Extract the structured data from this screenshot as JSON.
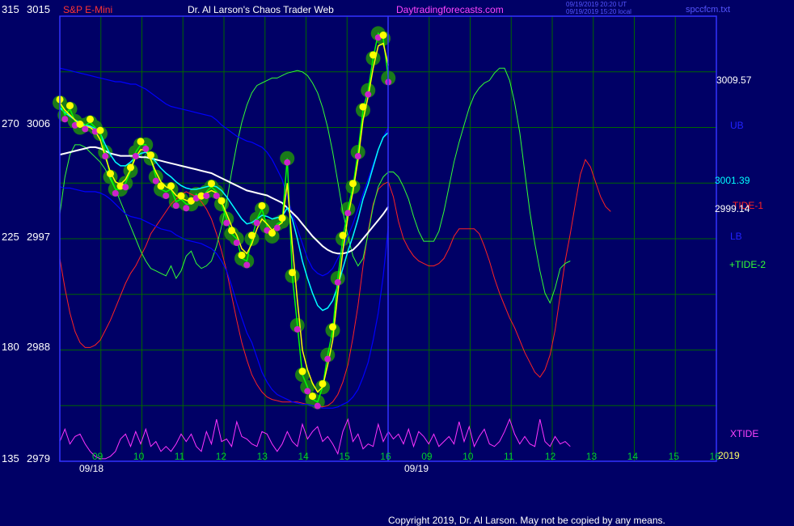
{
  "header": {
    "instrument": "S&P E-Mini",
    "site_title": "Dr. Al Larson's Chaos Trader Web",
    "site_url": "Daytradingforecasts.com",
    "timestamp_utc": "09/19/2019 20:20 UT",
    "timestamp_local": "09/19/2019 15:20 local",
    "file_name": "spccfcm.txt"
  },
  "footer": {
    "copyright": "Copyright 2019, Dr. Al Larson. May not be copied by any means."
  },
  "colors": {
    "background": "#000066",
    "border": "#3333ff",
    "grid": "#006600",
    "price": "#00ff00",
    "ub_lb": "#0000ff",
    "cyan_avg": "#00ffff",
    "white_avg": "#ffffff",
    "yellow_avg": "#ffff00",
    "tide1": "#ff2222",
    "tide2": "#33ff33",
    "xtide": "#ff33ff"
  },
  "chart_data": {
    "type": "line",
    "left_axis_a": [
      "315",
      "270",
      "225",
      "180",
      "135"
    ],
    "left_axis_b": [
      "3015",
      "3006",
      "2997",
      "2988",
      "2979"
    ],
    "price_range": [
      2979,
      3015
    ],
    "x_hour_labels": [
      "09",
      "10",
      "11",
      "12",
      "13",
      "14",
      "15",
      "16",
      "09",
      "10",
      "11",
      "12",
      "13",
      "14",
      "15",
      "16"
    ],
    "date_labels": [
      "09/18",
      "09/19"
    ],
    "year_label": "2019",
    "right_labels": {
      "upper_value": "3009.57",
      "ub": "UB",
      "mid_value": "3001.39",
      "tide1": "TIDE-1",
      "close_value": "2999.14",
      "lb": "LB",
      "tide2": "+TIDE-2",
      "xtide": "XTIDE"
    },
    "series": [
      {
        "key": "price",
        "values": [
          3008,
          3007,
          3007.5,
          3006.5,
          3006,
          3006.2,
          3006.4,
          3006,
          3005.5,
          3004,
          3002,
          3001,
          3001,
          3001.5,
          3002.5,
          3004,
          3004.6,
          3004.6,
          3003.5,
          3002,
          3001,
          3000.8,
          3001,
          3000,
          3000.2,
          2999.8,
          2999.8,
          3000.6,
          3000.2,
          3000.8,
          3001.2,
          3000.8,
          2999.8,
          2998.6,
          2997.4,
          2997,
          2995.4,
          2995.2,
          2997,
          2998.6,
          2999.4,
          2998,
          2997.2,
          2998.2,
          2998.4,
          3003.5,
          2994,
          2990,
          2986,
          2985,
          2984,
          2983.8,
          2985,
          2987.6,
          2989.6,
          2993.8,
          2997,
          2999.4,
          3001.2,
          3004,
          3007.4,
          3009,
          3011.6,
          3013.6,
          3013.2,
          3010
        ]
      },
      {
        "key": "yellow",
        "values": [
          3008,
          3007.4,
          3007,
          3006.6,
          3006.2,
          3006.1,
          3006,
          3005.7,
          3005,
          3003.6,
          3002.4,
          3001.6,
          3001.4,
          3001.8,
          3002.6,
          3003.6,
          3004.2,
          3004.2,
          3003.4,
          3002.4,
          3001.6,
          3001.2,
          3001,
          3000.5,
          3000.3,
          3000.1,
          3000,
          3000.3,
          3000.4,
          3000.7,
          3000.9,
          3000.7,
          3000,
          2999,
          2998,
          2997.3,
          2996.2,
          2995.8,
          2996.6,
          2997.8,
          2998.6,
          2998.2,
          2997.7,
          2998,
          2998.3,
          3001.5,
          2996.5,
          2992,
          2988,
          2986.4,
          2985.3,
          2984.6,
          2985,
          2986.8,
          2988.8,
          2992.6,
          2996,
          2998.8,
          3000.8,
          3003.4,
          3006.6,
          3008.5,
          3010.8,
          3012.6,
          3012.8,
          3011
        ]
      },
      {
        "key": "cyan",
        "values": [
          3007.6,
          3007.2,
          3006.9,
          3006.6,
          3006.4,
          3006.2,
          3006.1,
          3005.9,
          3005.5,
          3004.6,
          3003.8,
          3003.2,
          3002.9,
          3002.9,
          3003.2,
          3003.6,
          3003.9,
          3004,
          3003.7,
          3003.2,
          3002.7,
          3002.3,
          3002,
          3001.6,
          3001.3,
          3001.1,
          3001,
          3001,
          3001.1,
          3001.2,
          3001.3,
          3001.2,
          3000.9,
          3000.4,
          2999.8,
          2999.2,
          2998.6,
          2998.2,
          2998.3,
          2998.6,
          2998.9,
          2998.8,
          2998.6,
          2998.7,
          2998.8,
          2999.5,
          2998.6,
          2997,
          2995.2,
          2993.8,
          2992.6,
          2991.6,
          2991.2,
          2991.4,
          2992,
          2993.2,
          2994.6,
          2996,
          2997.2,
          2998.6,
          3000.2,
          3001.4,
          3002.8,
          3004.2,
          3005.2,
          3005.6
        ]
      },
      {
        "key": "white",
        "values": [
          3003.8,
          3003.9,
          3004,
          3004.1,
          3004.2,
          3004.3,
          3004.4,
          3004.4,
          3004.3,
          3004.1,
          3003.9,
          3003.8,
          3003.7,
          3003.7,
          3003.7,
          3003.7,
          3003.6,
          3003.6,
          3003.5,
          3003.4,
          3003.3,
          3003.2,
          3003.1,
          3003,
          3002.9,
          3002.8,
          3002.7,
          3002.6,
          3002.5,
          3002.4,
          3002.3,
          3002.1,
          3001.9,
          3001.7,
          3001.5,
          3001.3,
          3001.1,
          3000.9,
          3000.8,
          3000.7,
          3000.6,
          3000.5,
          3000.3,
          3000.1,
          2999.9,
          2999.5,
          2999.1,
          2998.7,
          2998.2,
          2997.7,
          2997.2,
          2996.8,
          2996.4,
          2996.1,
          2995.9,
          2995.8,
          2995.8,
          2995.9,
          2996.1,
          2996.5,
          2997,
          2997.5,
          2998,
          2998.5,
          2999,
          2999.6
        ]
      },
      {
        "key": "ub",
        "values": [
          3010.8,
          3010.7,
          3010.6,
          3010.5,
          3010.4,
          3010.3,
          3010.2,
          3010.1,
          3010,
          3009.9,
          3009.8,
          3009.7,
          3009.7,
          3009.6,
          3009.5,
          3009.5,
          3009.3,
          3009.1,
          3008.8,
          3008.5,
          3008.2,
          3007.9,
          3007.7,
          3007.6,
          3007.5,
          3007.4,
          3007.3,
          3007.2,
          3007.1,
          3007,
          3006.9,
          3006.6,
          3006.2,
          3005.9,
          3005.6,
          3005.3,
          3005.1,
          3004.9,
          3004.8,
          3004.6,
          3004.4,
          3004,
          3003.4,
          3002.6,
          3001.8,
          3000.4,
          2999,
          2997.8,
          2996.6,
          2995.4,
          2994.6,
          2994.2,
          2994,
          2994.2,
          2994.6,
          2995.4,
          2996.2,
          2997.2,
          2998.2,
          2999.4,
          3000.6,
          3001.8,
          3003,
          3004.2,
          3005.2,
          3006
        ]
      },
      {
        "key": "lb",
        "values": [
          3001.2,
          3001.1,
          3001.1,
          3001,
          3000.9,
          3000.8,
          3000.8,
          3000.8,
          3000.7,
          3000.5,
          3000.2,
          2999.8,
          2999.4,
          2999,
          2998.8,
          2998.7,
          2998.6,
          2998.4,
          2998.2,
          2998,
          2997.8,
          2997.7,
          2997.6,
          2997.3,
          2997.1,
          2996.9,
          2996.8,
          2996.7,
          2996.6,
          2996.4,
          2996.2,
          2995.8,
          2995.2,
          2994.4,
          2993.2,
          2991.8,
          2990.6,
          2989.4,
          2988.6,
          2987.4,
          2986.2,
          2985.4,
          2984.8,
          2984.4,
          2984.2,
          2984,
          2983.8,
          2983.7,
          2983.6,
          2983.6,
          2983.5,
          2983.4,
          2983.3,
          2983.3,
          2983.3,
          2983.4,
          2983.6,
          2983.8,
          2984.2,
          2984.8,
          2985.8,
          2987,
          2988.8,
          2991,
          2994,
          2998
        ]
      },
      {
        "key": "tide1",
        "values": [
          2995.4,
          2993,
          2991,
          2989.5,
          2988.6,
          2988.2,
          2988.2,
          2988.4,
          2988.8,
          2989.6,
          2990.4,
          2991.4,
          2992.4,
          2993.4,
          2994.2,
          2994.8,
          2995.6,
          2996.4,
          2997.4,
          2998,
          2998.6,
          2999.2,
          2999.8,
          3000.2,
          3000.6,
          3000.8,
          3000.6,
          3000.4,
          3000,
          2999.4,
          2998.6,
          2997.4,
          2996,
          2994.4,
          2992.4,
          2990.4,
          2988.6,
          2987.2,
          2986,
          2985.2,
          2984.6,
          2984.2,
          2984,
          2983.9,
          2983.8,
          2983.8,
          2983.8,
          2983.8,
          2983.7,
          2983.6,
          2983.5,
          2983.4,
          2983.4,
          2983.5,
          2983.8,
          2984.4,
          2985.4,
          2986.8,
          2989,
          2991.6,
          2994.8,
          2997.6,
          2999.8,
          3001,
          3001.4,
          3001.6,
          3000.4,
          2998.4,
          2997,
          2996.2,
          2995.6,
          2995.2,
          2995,
          2994.8,
          2994.8,
          2995,
          2995.4,
          2996.2,
          2997.2,
          2997.8,
          2997.8,
          2997.8,
          2997.8,
          2997.4,
          2996.4,
          2995.2,
          2993.8,
          2992.6,
          2991.6,
          2990.6,
          2989.8,
          2988.8,
          2987.8,
          2987,
          2986.2,
          2985.8,
          2986.4,
          2987.6,
          2989.6,
          2992.4,
          2995.2,
          2997.4,
          2999.8,
          3002.2,
          3003.4,
          3002.8,
          3001.6,
          3000.4,
          2999.6,
          2999.2
        ]
      },
      {
        "key": "tide2",
        "values": [
          2999,
          3002,
          3003.8,
          3004.6,
          3004.6,
          3004.4,
          3004,
          3003.6,
          3003.2,
          3002.6,
          3001.8,
          3001,
          3000,
          2999,
          2998,
          2997,
          2996,
          2995.2,
          2994.6,
          2994.4,
          2994.2,
          2994,
          2994.8,
          2993.8,
          2994.4,
          2995.6,
          2996,
          2995,
          2994.6,
          2994.8,
          2995.2,
          2996.4,
          2998,
          3000,
          3002.4,
          3004.6,
          3006.4,
          3007.8,
          3008.8,
          3009.4,
          3009.6,
          3009.8,
          3010,
          3010,
          3010.2,
          3010.4,
          3010.5,
          3010.6,
          3010.5,
          3010.2,
          3009.6,
          3008.8,
          3007.6,
          3006,
          3004,
          3001.6,
          2999.2,
          2997.2,
          2995.6,
          2994.8,
          2995.4,
          2997.4,
          2999.6,
          3001.2,
          3002,
          3002.4,
          3002.4,
          3002,
          3001.2,
          3000.2,
          2998.8,
          2997.6,
          2996.8,
          2996.8,
          2996.8,
          2997.6,
          2999.2,
          3001.2,
          3003.2,
          3004.8,
          3006.2,
          3007.6,
          3008.6,
          3009.2,
          3009.6,
          3009.8,
          3010.4,
          3010.8,
          3010.8,
          3009.8,
          3008,
          3005.6,
          3002.4,
          2999.2,
          2996.6,
          2994.4,
          2992.6,
          2991.8,
          2993,
          2994.6,
          2995,
          2995.2
        ]
      },
      {
        "key": "xtide",
        "values": [
          2980.6,
          2981.6,
          2980.4,
          2981,
          2981.2,
          2980.4,
          2979.8,
          2979.4,
          2979.2,
          2979.2,
          2979.4,
          2979.8,
          2980.8,
          2981.2,
          2980.2,
          2981.4,
          2980.4,
          2981.6,
          2980.2,
          2980.6,
          2979.8,
          2980.2,
          2979.8,
          2980.4,
          2981.2,
          2980.6,
          2981.2,
          2980.2,
          2979.8,
          2981.4,
          2980.4,
          2982.4,
          2980.6,
          2980.8,
          2980.2,
          2982.2,
          2981,
          2980.8,
          2980.4,
          2980.2,
          2981.4,
          2981.2,
          2980.4,
          2979.8,
          2980.4,
          2981.4,
          2980.6,
          2980.2,
          2982,
          2980.8,
          2981.4,
          2981.8,
          2980.6,
          2981,
          2980.4,
          2979.6,
          2981.4,
          2982.4,
          2980.6,
          2981.2,
          2980,
          2980.4,
          2980.2,
          2982,
          2980.6,
          2981.4,
          2980.8,
          2981.2,
          2980.4,
          2981.6,
          2980.2,
          2981.4,
          2981,
          2980.4,
          2981.2,
          2980.2,
          2980.6,
          2981,
          2980.4,
          2982.2,
          2980.6,
          2981.8,
          2980.2,
          2981,
          2981.6,
          2980.4,
          2980.2,
          2980.6,
          2981.4,
          2982.4,
          2981.2,
          2980.4,
          2981,
          2980.4,
          2980.2,
          2982.4,
          2980.6,
          2980.2,
          2981,
          2980.4,
          2980.6,
          2980.2
        ]
      }
    ]
  }
}
